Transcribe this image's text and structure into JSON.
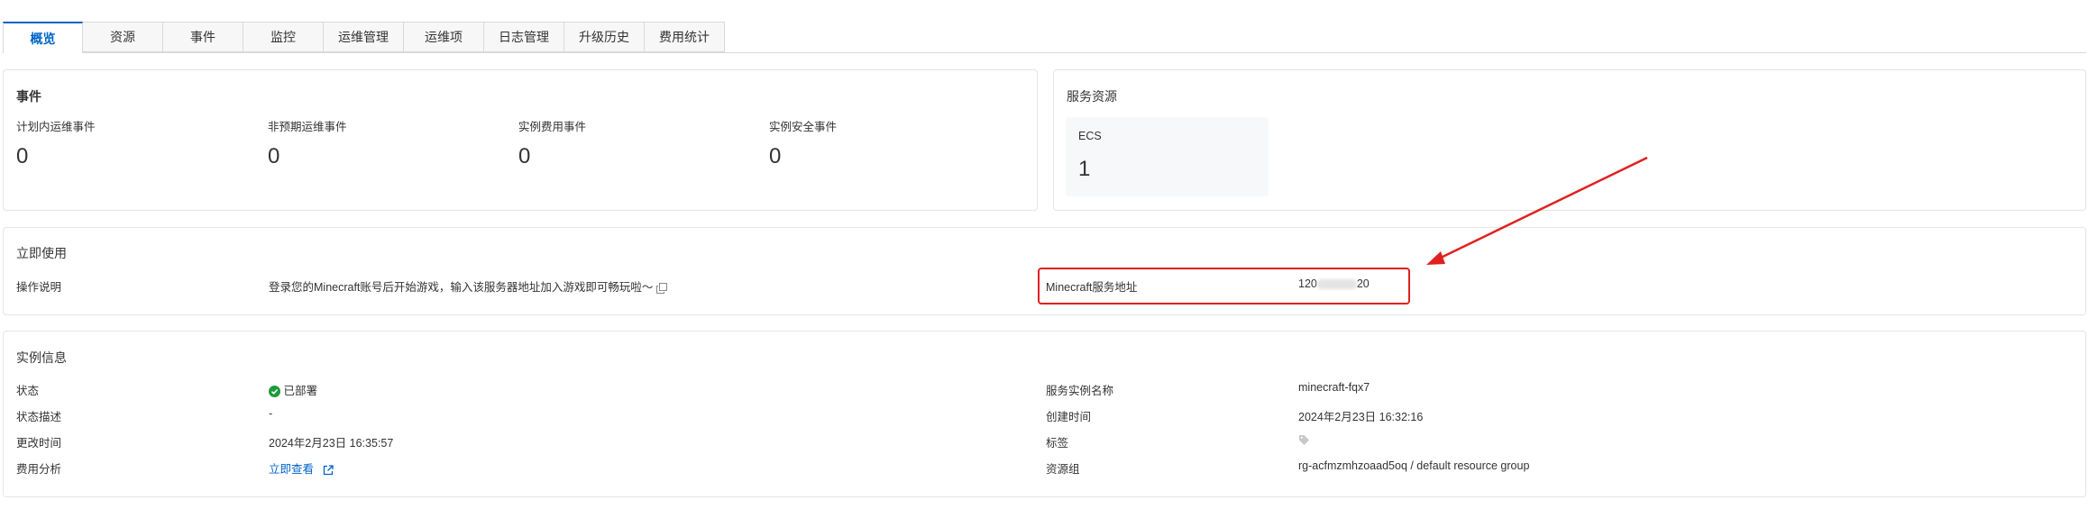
{
  "tabs": [
    {
      "label": "概览",
      "active": true
    },
    {
      "label": "资源",
      "active": false
    },
    {
      "label": "事件",
      "active": false
    },
    {
      "label": "监控",
      "active": false
    },
    {
      "label": "运维管理",
      "active": false
    },
    {
      "label": "运维项",
      "active": false
    },
    {
      "label": "日志管理",
      "active": false
    },
    {
      "label": "升级历史",
      "active": false
    },
    {
      "label": "费用统计",
      "active": false
    }
  ],
  "events": {
    "title": "事件",
    "items": [
      {
        "label": "计划内运维事件",
        "value": "0"
      },
      {
        "label": "非预期运维事件",
        "value": "0"
      },
      {
        "label": "实例费用事件",
        "value": "0"
      },
      {
        "label": "实例安全事件",
        "value": "0"
      }
    ]
  },
  "resources": {
    "title": "服务资源",
    "ecs": {
      "label": "ECS",
      "value": "1"
    }
  },
  "usage": {
    "title": "立即使用",
    "instruction_label": "操作说明",
    "instruction_text": "登录您的Minecraft账号后开始游戏，输入该服务器地址加入游戏即可畅玩啦～",
    "address_label": "Minecraft服务地址",
    "address_prefix": "120",
    "address_suffix": "20"
  },
  "instance": {
    "title": "实例信息",
    "status_label": "状态",
    "status_value": "已部署",
    "status_desc_label": "状态描述",
    "status_desc_value": "-",
    "update_time_label": "更改时间",
    "update_time_value": "2024年2月23日 16:35:57",
    "cost_label": "费用分析",
    "cost_link": "立即查看",
    "name_label": "服务实例名称",
    "name_value": "minecraft-fqx7",
    "create_time_label": "创建时间",
    "create_time_value": "2024年2月23日 16:32:16",
    "tags_label": "标签",
    "group_label": "资源组",
    "group_value": "rg-acfmzmhzoaad5oq / default resource group"
  },
  "colors": {
    "accent": "#0064c8",
    "success": "#1e9a3a",
    "annotation": "#e02020"
  }
}
